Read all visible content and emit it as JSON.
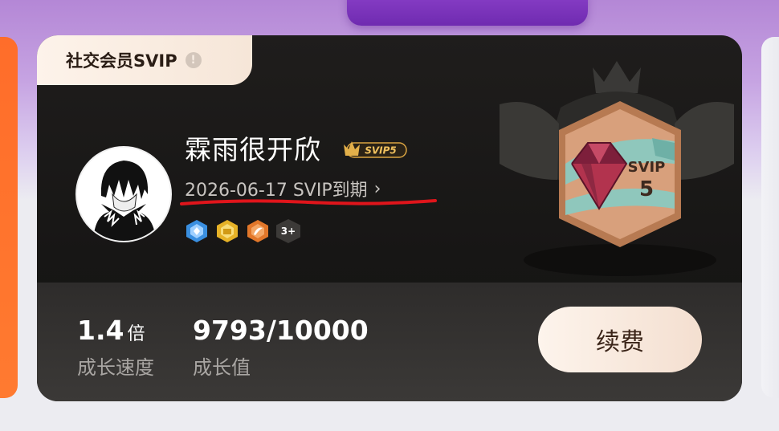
{
  "card": {
    "tag_label": "社交会员SVIP",
    "info_glyph": "!",
    "username": "霖雨很开欣",
    "level_badge": "SVIP5",
    "expire_text": "2026-06-17 SVIP到期",
    "more_medals": "3+",
    "emblem": {
      "label": "SVIP",
      "level": "5"
    },
    "growth_speed": {
      "value": "1.4",
      "unit": "倍",
      "label": "成长速度"
    },
    "growth_value": {
      "value": "9793/10000",
      "label": "成长值"
    },
    "renew_label": "续费"
  },
  "icons": [
    "info-icon",
    "svip-crown-badge-icon",
    "chevron-right-icon",
    "diamond-medal-icon",
    "gold-medal-icon",
    "orange-medal-icon",
    "svip-gem-emblem-icon"
  ],
  "colors": {
    "card_bg": "#1a1918",
    "accent_gold": "#d9a441",
    "annotation_red": "#e0151b",
    "button_bg": "#f7e6da"
  }
}
